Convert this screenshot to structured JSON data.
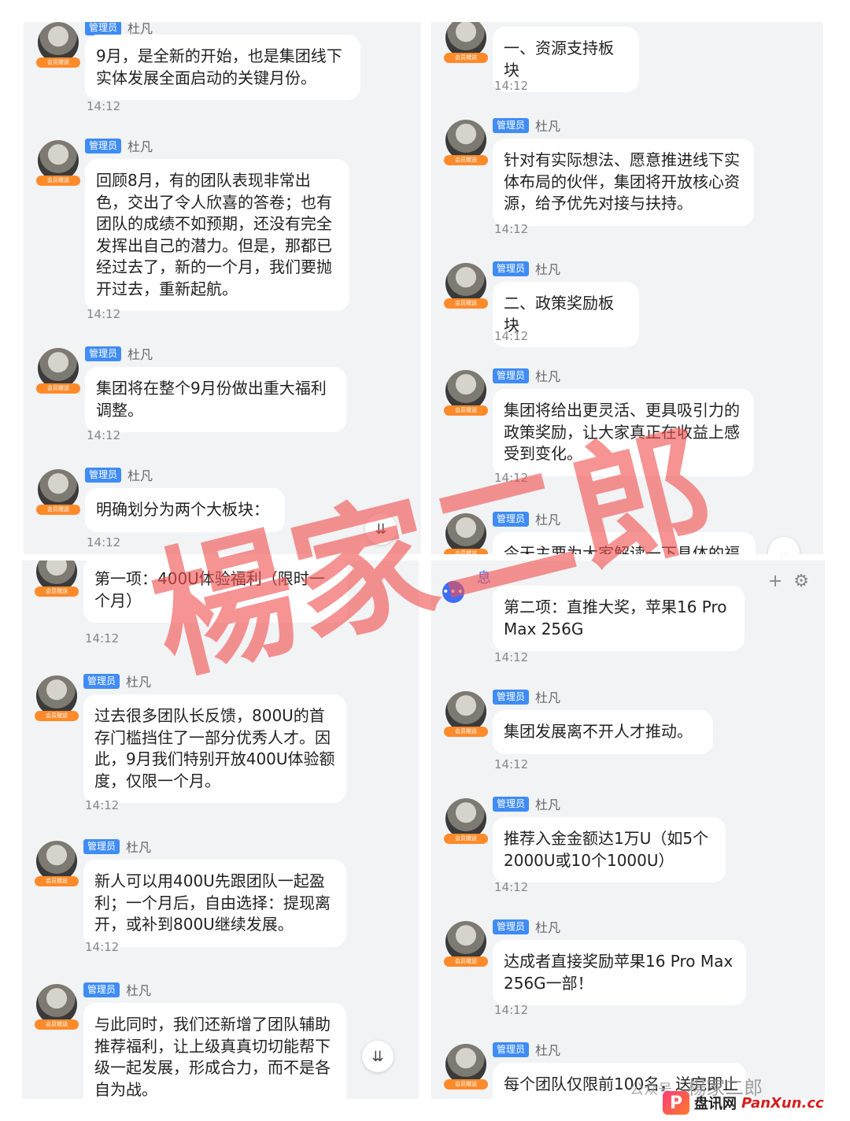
{
  "common": {
    "badge": "管理员",
    "sender": "杜凡",
    "avatar_tag": "会员赠送"
  },
  "panel1": {
    "messages": [
      {
        "text": "9月，是全新的开始，也是集团线下实体发展全面启动的关键月份。",
        "time": "14:12"
      },
      {
        "text": "回顾8月，有的团队表现非常出色，交出了令人欣喜的答卷；也有团队的成绩不如预期，还没有完全发挥出自己的潜力。但是，那都已经过去了，新的一个月，我们要抛开过去，重新起航。",
        "time": "14:12"
      },
      {
        "text": "集团将在整个9月份做出重大福利调整。",
        "time": "14:12"
      },
      {
        "text": "明确划分为两个大板块：",
        "time": "14:12"
      }
    ]
  },
  "panel2": {
    "messages": [
      {
        "text": "一、资源支持板块",
        "time": "14:12"
      },
      {
        "text": "针对有实际想法、愿意推进线下实体布局的伙伴，集团将开放核心资源，给予优先对接与扶持。",
        "time": "14:12"
      },
      {
        "text": "二、政策奖励板块",
        "time": "14:12"
      },
      {
        "text": "集团将给出更灵活、更具吸引力的政策奖励，让大家真正在收益上感受到变化。",
        "time": "14:12"
      },
      {
        "text": "今天主要为大家解读一下具体的福"
      }
    ]
  },
  "panel3": {
    "messages": [
      {
        "text": "第一项：400U体验福利（限时一个月）",
        "time": "14:12"
      },
      {
        "text": "过去很多团队长反馈，800U的首存门槛挡住了一部分优秀人才。因此，9月我们特别开放400U体验额度，仅限一个月。",
        "time": "14:12"
      },
      {
        "text": "新人可以用400U先跟团队一起盈利；一个月后，自由选择：提现离开，或补到800U继续发展。",
        "time": "14:12"
      },
      {
        "text": "与此同时，我们还新增了团队辅助推荐福利，让上级真真切切能帮下级一起发展，形成合力，而不是各自为战。"
      }
    ]
  },
  "panel4": {
    "header_partial": "息",
    "messages": [
      {
        "text": "第二项：直推大奖，苹果16 Pro Max 256G",
        "time": "14:12"
      },
      {
        "text": "集团发展离不开人才推动。",
        "time": "14:12"
      },
      {
        "text": "推荐入金金额达1万U（如5个2000U或10个1000U）",
        "time": "14:12"
      },
      {
        "text": "达成者直接奖励苹果16 Pro Max 256G一部！",
        "time": "14:12"
      },
      {
        "text": "每个团队仅限前100名，送完即止"
      }
    ]
  },
  "watermark": "楊家二郎",
  "footer": {
    "account_prefix": "公众号 ·",
    "account": "楊家二郎",
    "logo_letter": "P",
    "site_cn": "盘讯网",
    "site_en": "PanXun.cc"
  },
  "icons": [
    "chevron-double-down-icon",
    "plus-icon",
    "gear-icon",
    "more-icon"
  ]
}
